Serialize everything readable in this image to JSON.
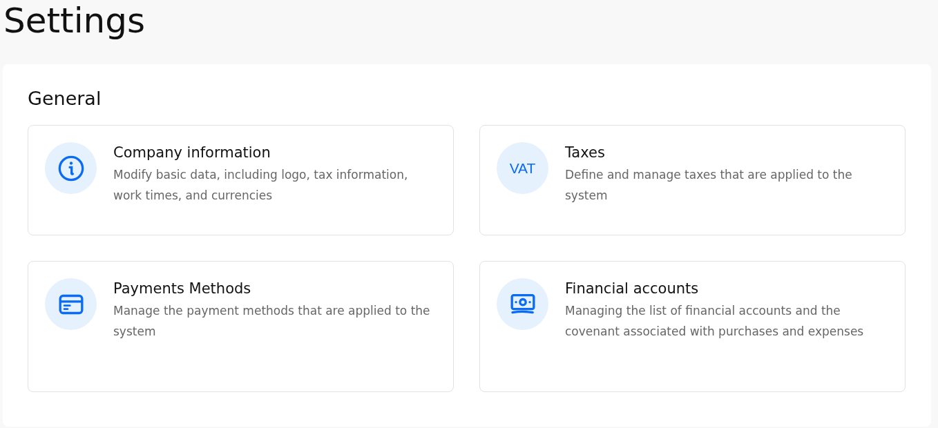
{
  "page_title": "Settings",
  "section": {
    "title": "General",
    "cards": [
      {
        "kind": "info",
        "title": "Company information",
        "description": "Modify basic data, including logo, tax information, work times, and currencies"
      },
      {
        "kind": "text",
        "icon_text": "VAT",
        "title": "Taxes",
        "description": "Define and manage taxes that are applied to the system"
      },
      {
        "kind": "card",
        "title": "Payments Methods",
        "description": "Manage the payment methods that are applied to the system"
      },
      {
        "kind": "money",
        "title": "Financial accounts",
        "description": "Managing the list of financial accounts and the covenant associated with purchases and expenses"
      }
    ]
  }
}
